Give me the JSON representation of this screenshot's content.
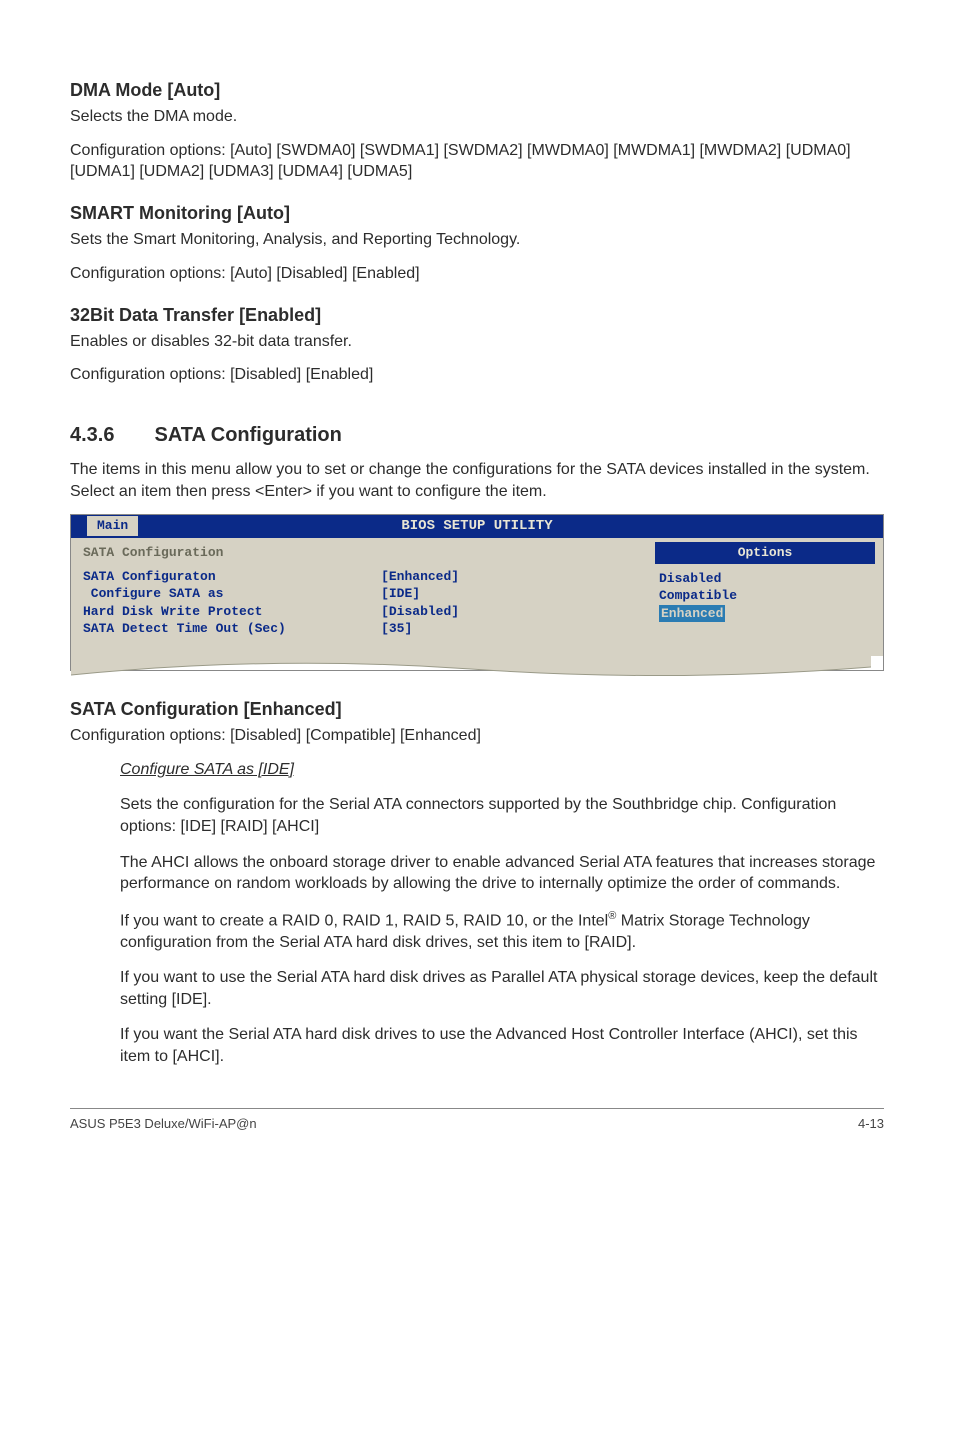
{
  "dma": {
    "title": "DMA Mode [Auto]",
    "line1": "Selects the DMA mode.",
    "line2": "Configuration options: [Auto] [SWDMA0] [SWDMA1] [SWDMA2] [MWDMA0] [MWDMA1] [MWDMA2] [UDMA0] [UDMA1] [UDMA2] [UDMA3] [UDMA4] [UDMA5]"
  },
  "smart": {
    "title": "SMART Monitoring [Auto]",
    "line1": "Sets the Smart Monitoring, Analysis, and Reporting Technology.",
    "line2": "Configuration options: [Auto] [Disabled] [Enabled]"
  },
  "xfer32": {
    "title": "32Bit Data Transfer [Enabled]",
    "line1": "Enables or disables 32-bit data transfer.",
    "line2": "Configuration options: [Disabled] [Enabled]"
  },
  "section": {
    "num": "4.3.6",
    "title": "SATA Configuration",
    "intro": "The items in this menu allow you to set or change the configurations for the SATA devices installed in the system. Select an item then press <Enter> if you want to configure the item."
  },
  "bios": {
    "bar_title": "BIOS SETUP UTILITY",
    "tab": "Main",
    "left_header": "SATA Configuration",
    "rows": [
      {
        "label": "SATA Configuraton",
        "value": "[Enhanced]"
      },
      {
        "label": " Configure SATA as",
        "value": "[IDE]"
      },
      {
        "label": "",
        "value": ""
      },
      {
        "label": "Hard Disk Write Protect",
        "value": "[Disabled]"
      },
      {
        "label": "SATA Detect Time Out (Sec)",
        "value": "[35]"
      }
    ],
    "options_header": "Options",
    "options": [
      "Disabled",
      "Compatible",
      "Enhanced"
    ],
    "selected_index": 2
  },
  "sata_enh": {
    "title": "SATA Configuration [Enhanced]",
    "line": "Configuration options: [Disabled] [Compatible] [Enhanced]"
  },
  "cfg_ide": {
    "link": "Configure SATA as [IDE]",
    "p1": "Sets the configuration for the Serial ATA connectors supported by the Southbridge chip. Configuration options: [IDE] [RAID] [AHCI]",
    "p2": "The AHCI allows the onboard storage driver to enable advanced Serial ATA features that increases storage performance on random workloads by allowing the drive to internally optimize the order of commands.",
    "p3a": "If you want to create a RAID 0, RAID 1, RAID 5, RAID 10, or the Intel",
    "p3sup": "®",
    "p3b": " Matrix Storage Technology configuration from the Serial ATA hard disk drives, set this item to [RAID].",
    "p4": "If you want to use the Serial ATA hard disk drives as Parallel ATA physical storage devices, keep the default setting [IDE].",
    "p5": "If you want the Serial ATA hard disk drives to use the Advanced Host Controller Interface (AHCI), set this item to [AHCI]."
  },
  "footer": {
    "left": "ASUS P5E3 Deluxe/WiFi-AP@n",
    "right": "4-13"
  }
}
